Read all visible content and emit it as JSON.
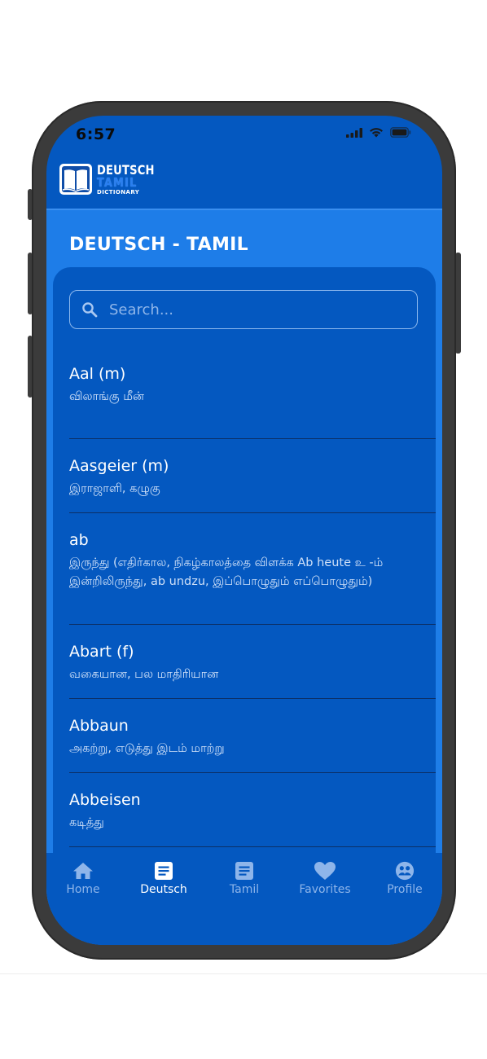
{
  "status_bar": {
    "time": "6:57"
  },
  "app": {
    "logo": {
      "line1": "DEUTSCH",
      "line2": "TAMIL",
      "line3": "DICTIONARY"
    },
    "title": "DEUTSCH - TAMIL"
  },
  "search": {
    "placeholder": "Search..."
  },
  "entries": [
    {
      "word": "Aal (m)",
      "meaning": "விலாங்கு மீன்"
    },
    {
      "word": "Aasgeier (m)",
      "meaning": "இராஜாளி, கழுகு"
    },
    {
      "word": "ab",
      "meaning": "இருந்து (எதிர்கால, நிகழ்காலத்தை விளக்க Ab heute உ -ம் இன்றிலிருந்து, ab undzu, இப்பொழுதும் எப்பொழுதும்)"
    },
    {
      "word": "Abart (f)",
      "meaning": "வகையான, பல மாதிரியான"
    },
    {
      "word": "Abbaun",
      "meaning": "அகற்று, எடுத்து இடம் மாற்று"
    },
    {
      "word": "Abbeisen",
      "meaning": "கடித்து"
    }
  ],
  "nav": [
    {
      "label": "Home",
      "icon": "home-icon",
      "active": false
    },
    {
      "label": "Deutsch",
      "icon": "document-icon",
      "active": true
    },
    {
      "label": "Tamil",
      "icon": "document-icon",
      "active": false
    },
    {
      "label": "Favorites",
      "icon": "heart-icon",
      "active": false
    },
    {
      "label": "Profile",
      "icon": "profile-icon",
      "active": false
    }
  ],
  "colors": {
    "primary": "#0458c0",
    "header": "#1e7de8",
    "nav_active": "#ffffff",
    "nav_inactive": "#8eb5ea"
  }
}
